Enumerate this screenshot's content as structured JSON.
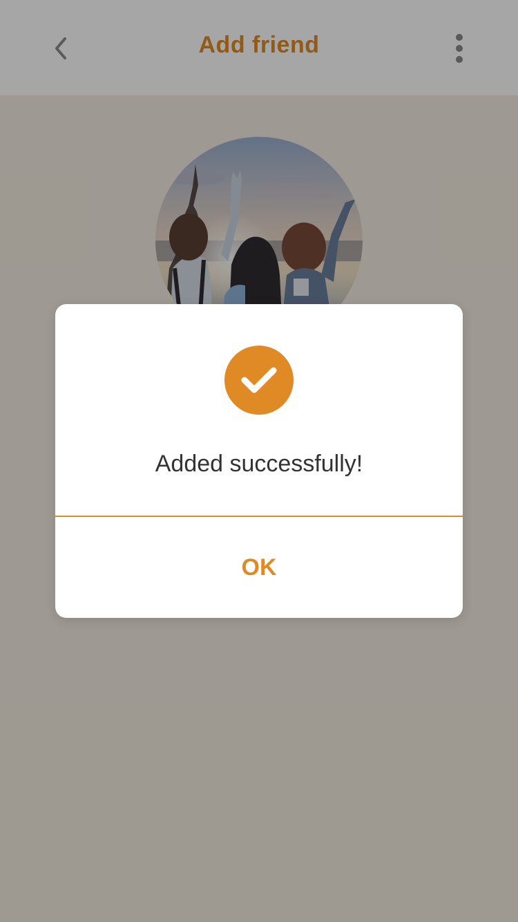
{
  "header": {
    "title": "Add friend",
    "back_icon": "chevron-left-icon",
    "more_icon": "more-vertical-icon"
  },
  "profile": {
    "avatar_icon": "friends-photo-avatar"
  },
  "dialog": {
    "icon": "check-circle-icon",
    "message": "Added successfully!",
    "ok_label": "OK"
  },
  "colors": {
    "accent": "#e08a25",
    "background": "#f3ece0",
    "text": "#333333",
    "icon_gray": "#8a8a8a"
  }
}
